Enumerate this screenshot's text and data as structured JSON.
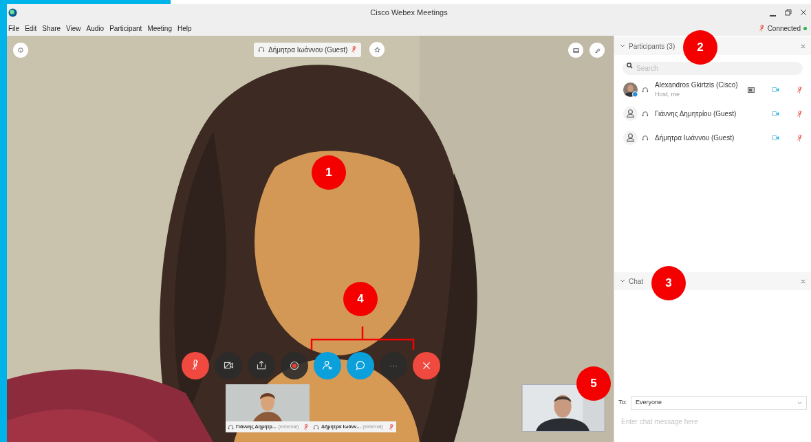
{
  "window": {
    "title": "Cisco Webex Meetings"
  },
  "menu": [
    "File",
    "Edit",
    "Share",
    "View",
    "Audio",
    "Participant",
    "Meeting",
    "Help"
  ],
  "status": {
    "text": "Connected",
    "mic_muted": true,
    "connected": true
  },
  "video": {
    "kind": "picture",
    "speaker_label": "Δήμητρα Ιωάννου (Guest)",
    "speaker_muted": true
  },
  "controls": [
    {
      "kind": "mute",
      "muted": true
    },
    {
      "kind": "video"
    },
    {
      "kind": "share"
    },
    {
      "kind": "record"
    },
    {
      "kind": "participants",
      "selected": true
    },
    {
      "kind": "chat",
      "selected": true
    },
    {
      "kind": "more",
      "label": "···"
    },
    {
      "kind": "leave"
    }
  ],
  "thumbnails": [
    {
      "name": "Γιάννης Δημητρ...",
      "tag": "(external)",
      "muted": true,
      "has_video": true
    },
    {
      "name": "Δήμητρα Ιωάνν...",
      "tag": "(external)",
      "muted": true,
      "has_video": false
    }
  ],
  "participants": {
    "title": "Participants (3)",
    "search_placeholder": "Search",
    "items": [
      {
        "name": "Alexandros Gkirtzis (Cisco)",
        "role": "Host, me",
        "muted": true,
        "sharing": true
      },
      {
        "kind": "generic",
        "name": "Γιάννης Δημητρίου (Guest)",
        "muted": true,
        "sharing": false
      },
      {
        "kind": "generic",
        "name": "Δήμητρα Ιωάννου (Guest)",
        "muted": true,
        "sharing": false
      }
    ]
  },
  "chat": {
    "title": "Chat",
    "to_label": "To:",
    "recipient": "Everyone",
    "placeholder": "Enter chat message here"
  },
  "annotations": [
    "1",
    "2",
    "3",
    "4",
    "5"
  ]
}
